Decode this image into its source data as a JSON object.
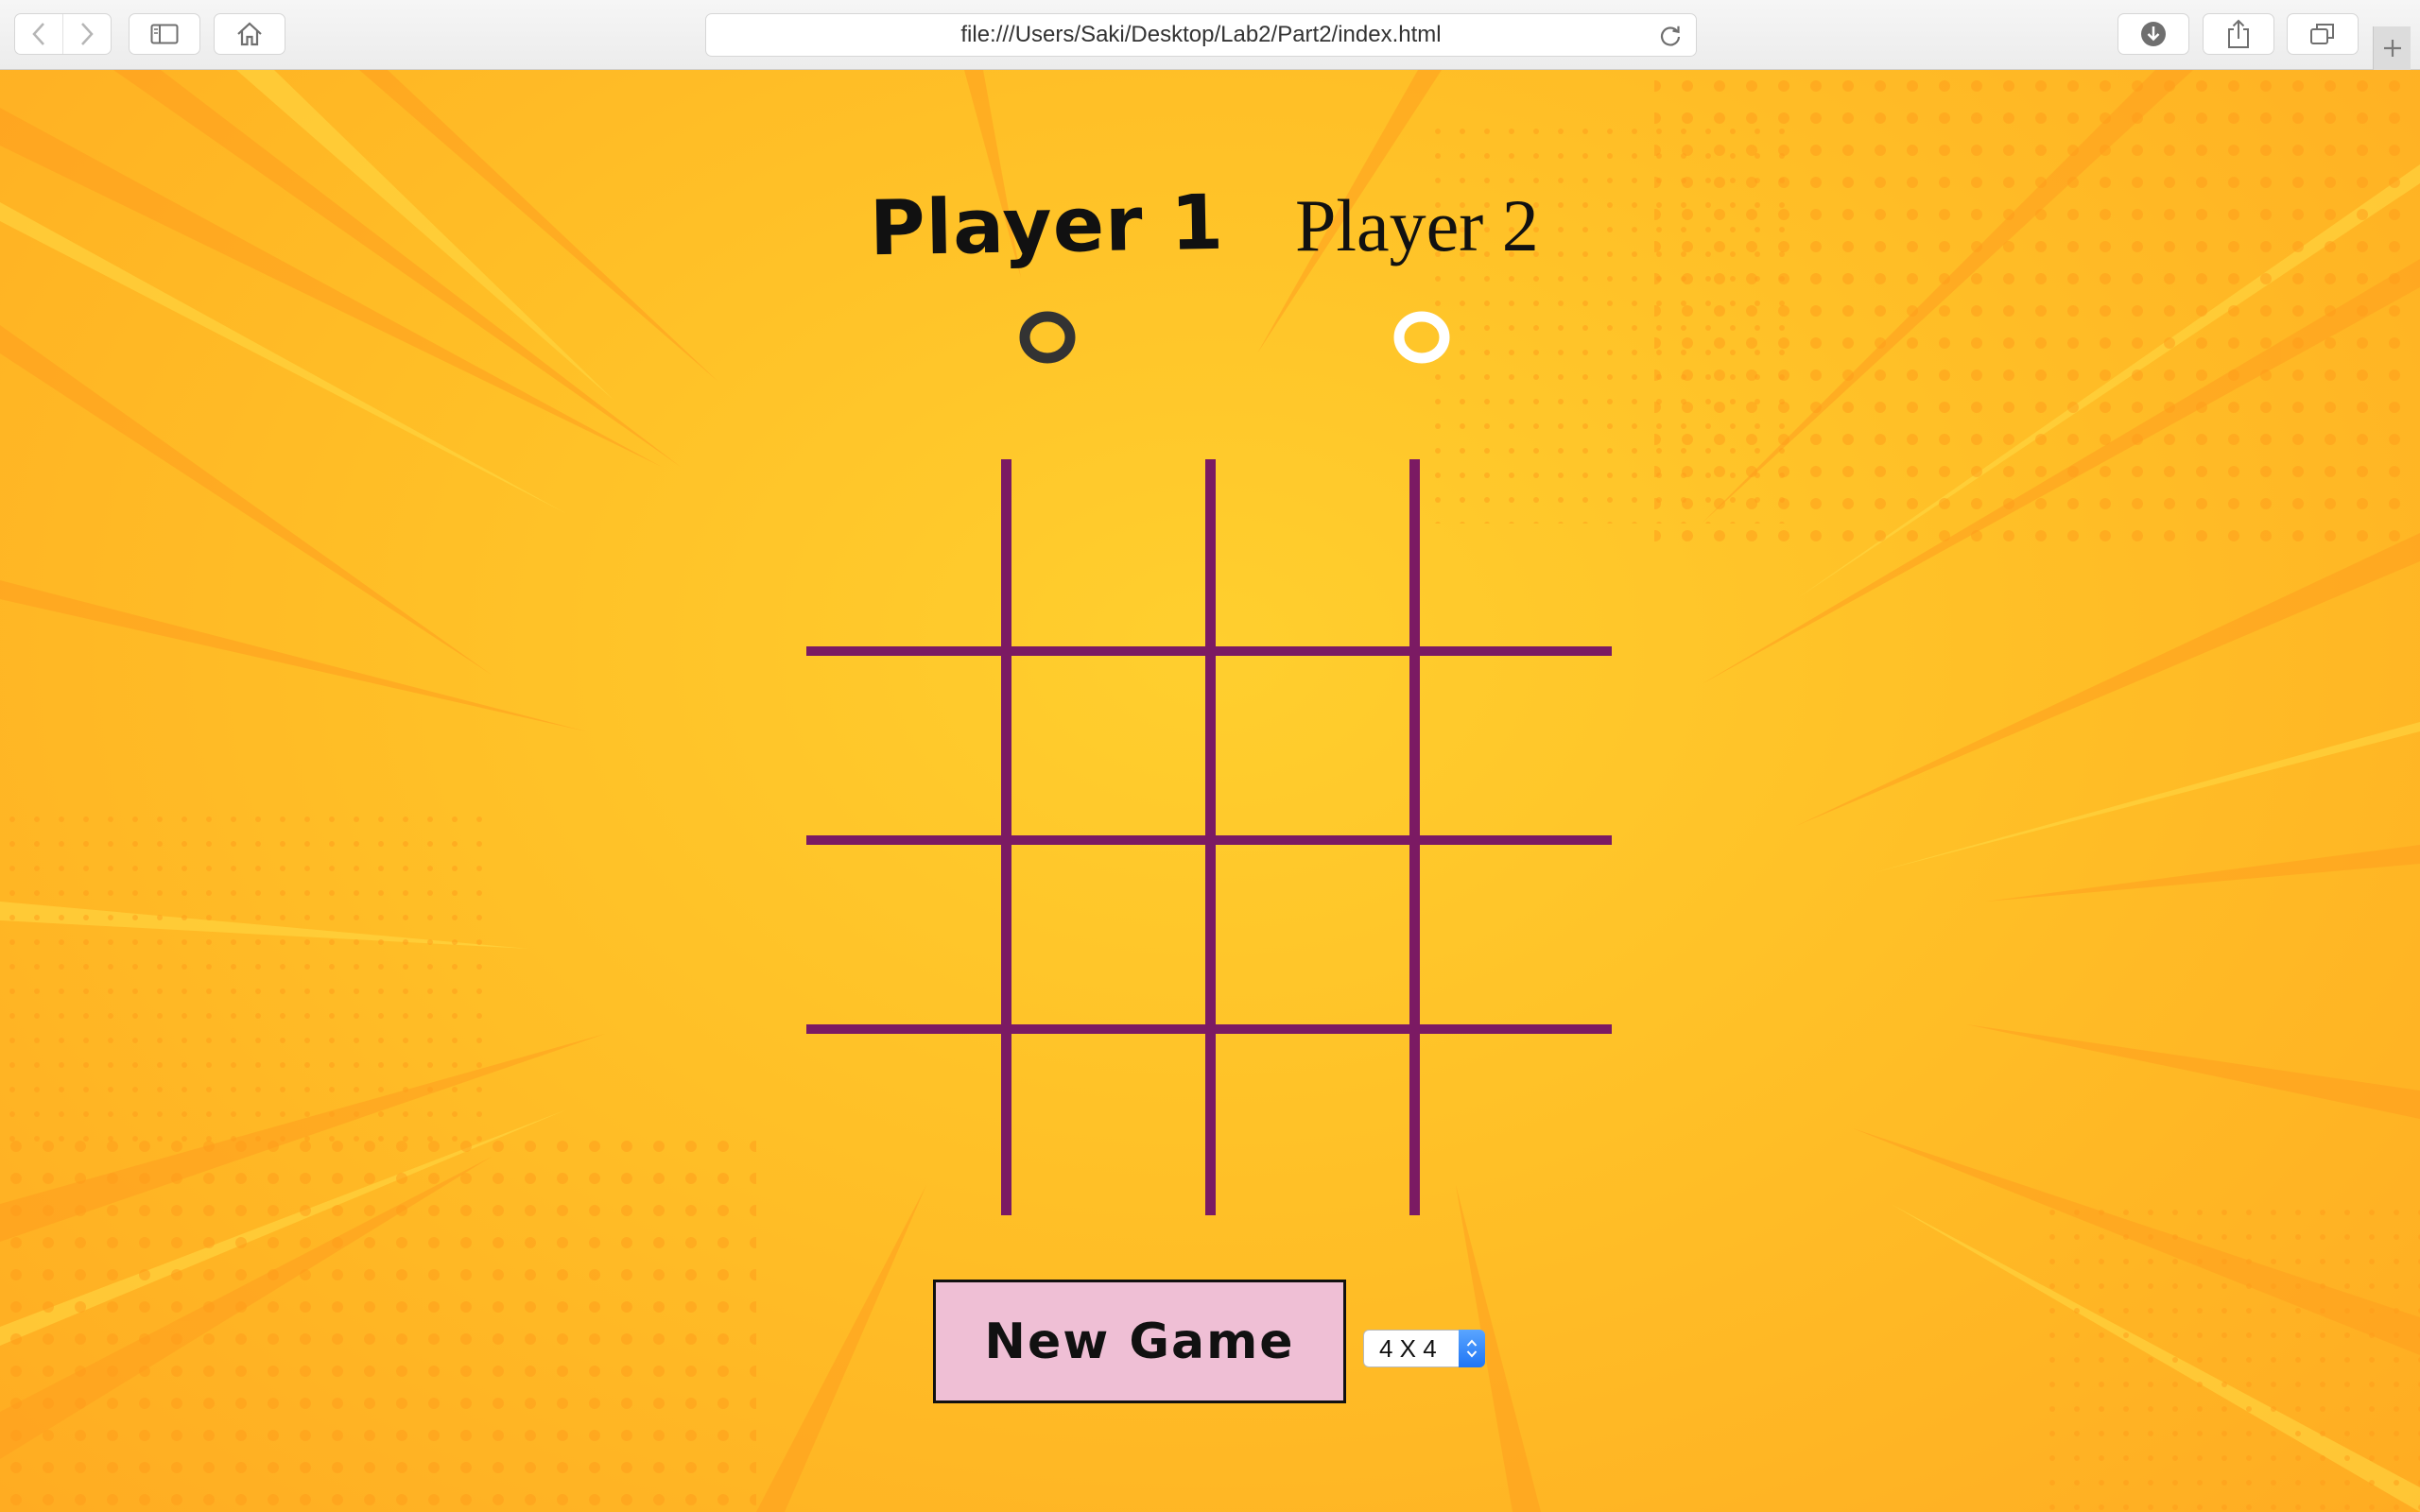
{
  "browser": {
    "url": "file:///Users/Saki/Desktop/Lab2/Part2/index.html"
  },
  "game": {
    "player1": {
      "name": "Player 1",
      "symbol": "O",
      "symbol_color": "#333333"
    },
    "player2": {
      "name": "Player 2",
      "symbol": "O",
      "symbol_color": "#ffffff"
    },
    "board": {
      "rows": 4,
      "cols": 4,
      "line_color": "#7b1a63",
      "cells": [
        "",
        "",
        "",
        "",
        "",
        "",
        "",
        "",
        "",
        "",
        "",
        "",
        "",
        "",
        "",
        ""
      ]
    },
    "new_game_label": "New Game",
    "size_select": {
      "selected": "4 X 4"
    }
  },
  "colors": {
    "background": "#ffc027",
    "button_bg": "#efbfd5"
  }
}
